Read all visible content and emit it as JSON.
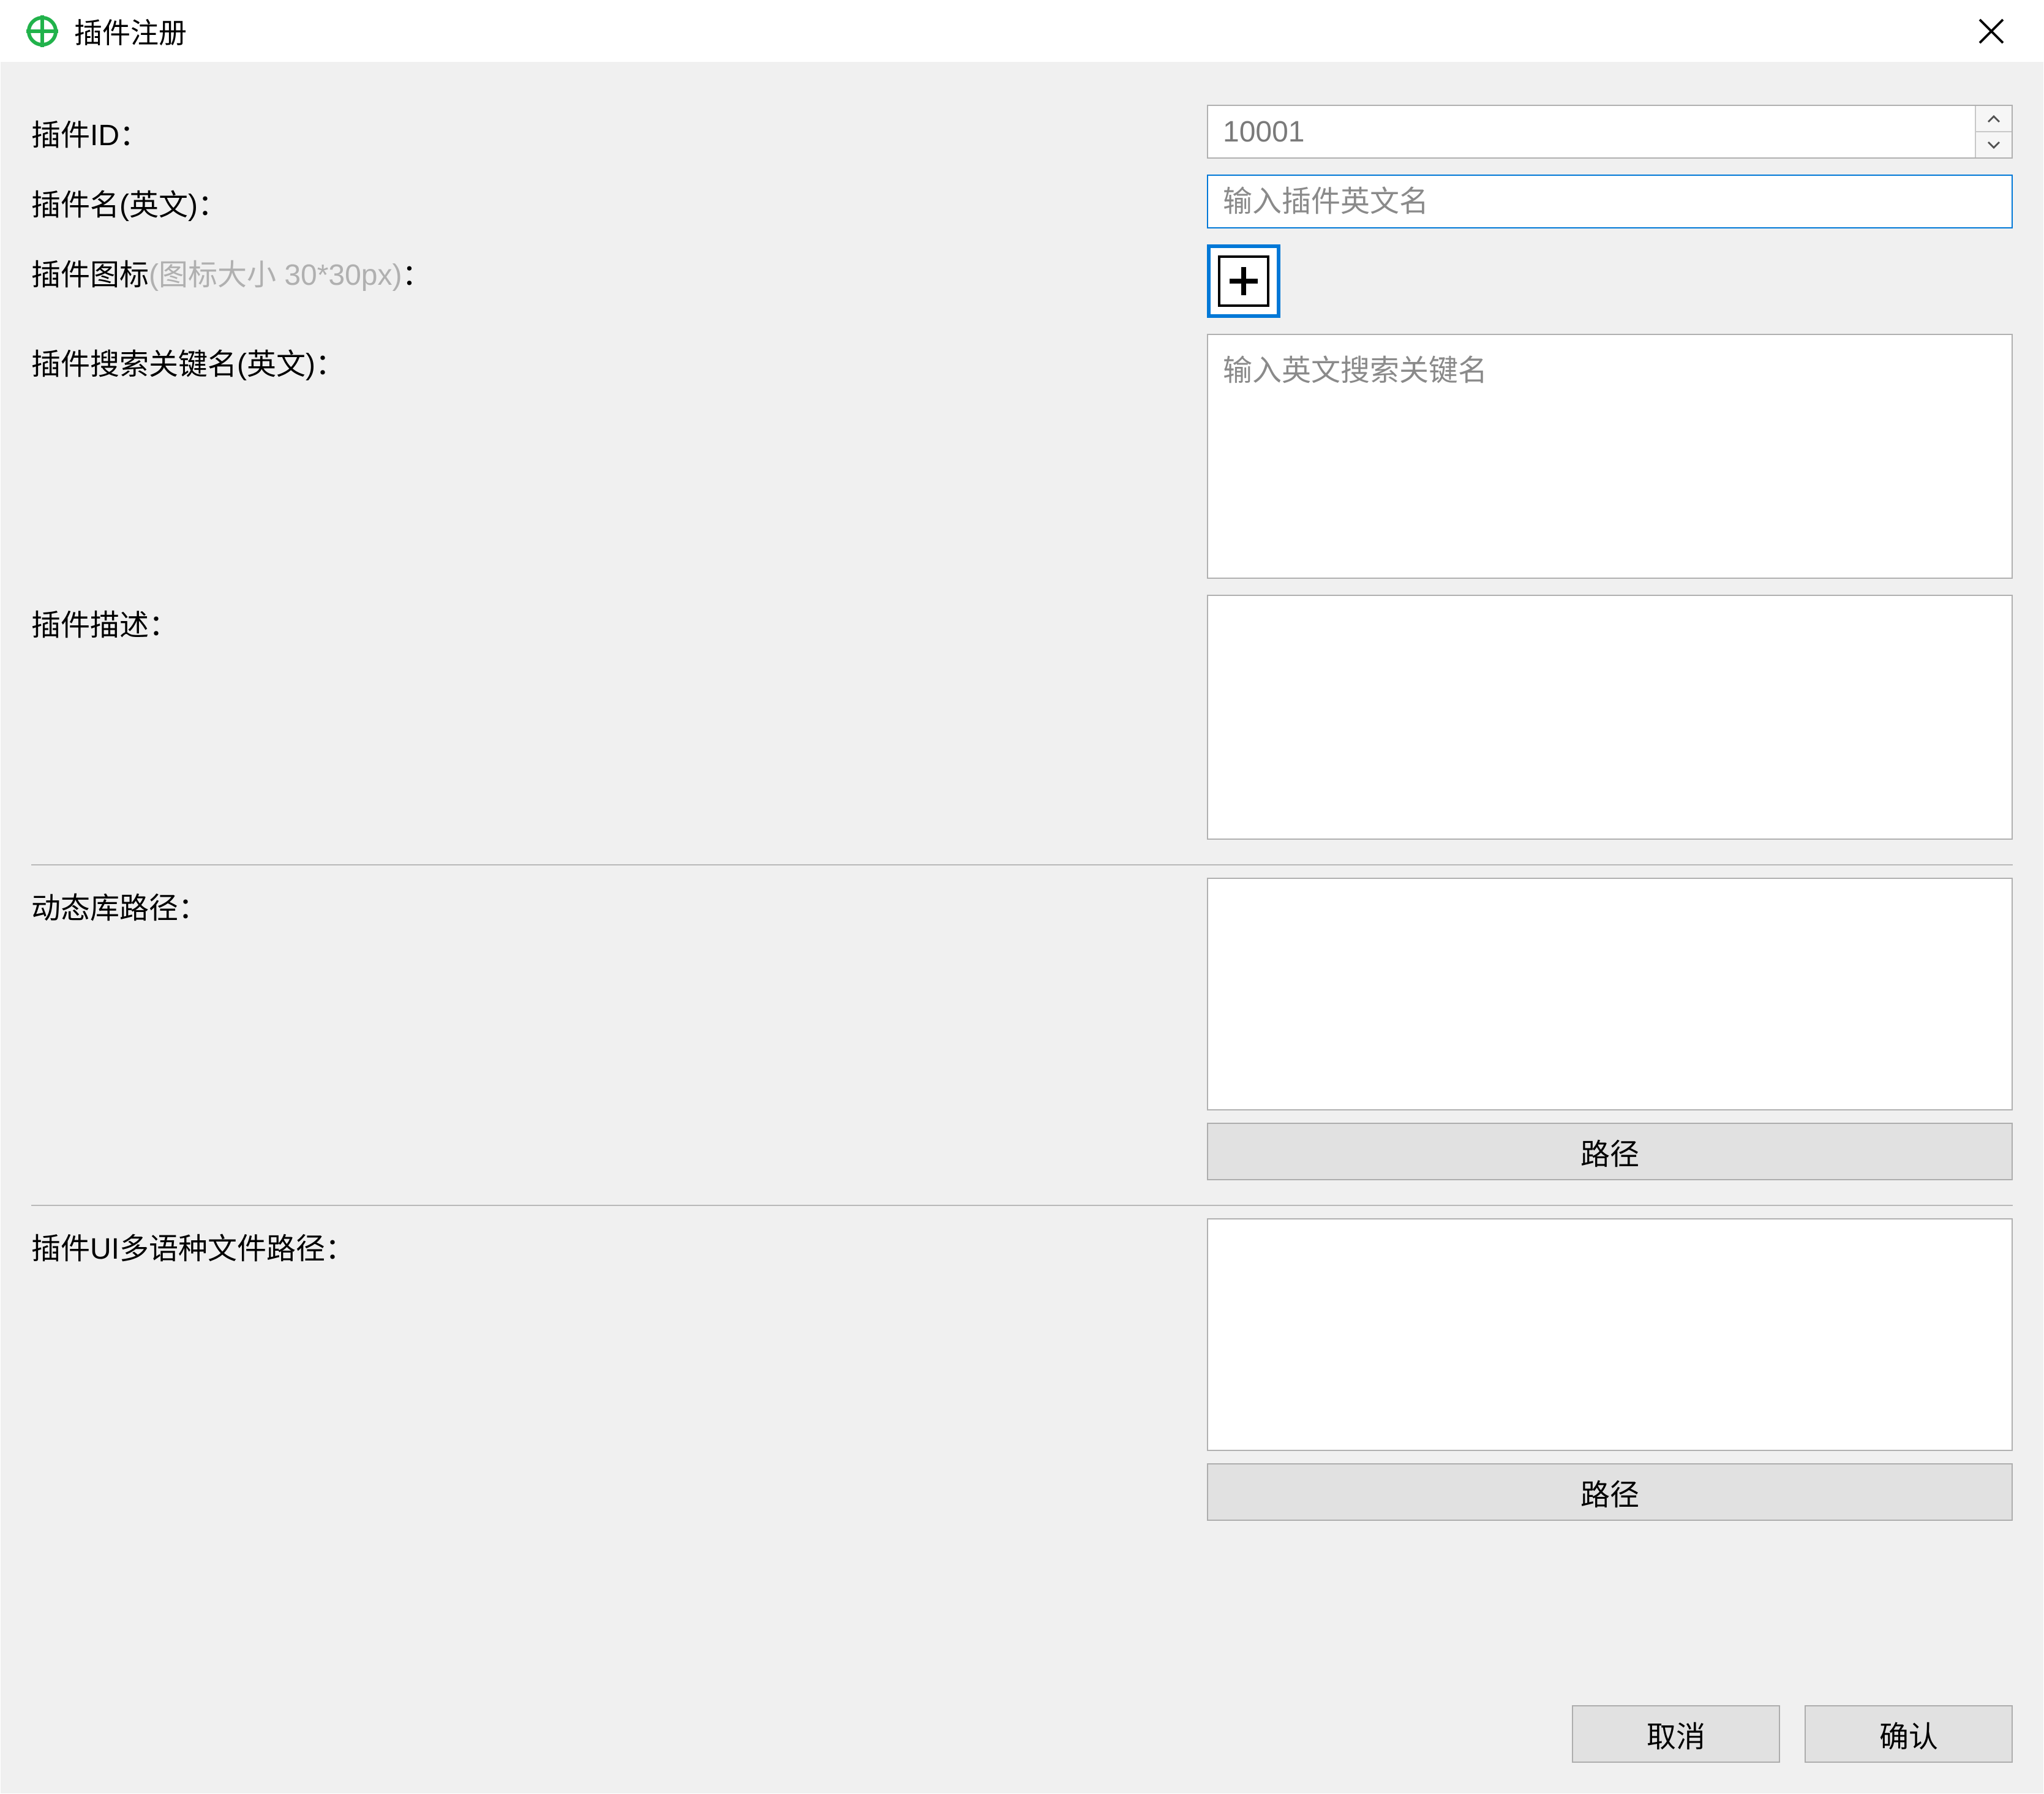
{
  "titlebar": {
    "title": "插件注册"
  },
  "sections": {
    "sec1": {
      "plugin_id": {
        "label": "插件ID：",
        "value": "10001"
      },
      "plugin_name_en": {
        "label": "插件名(英文)：",
        "placeholder": "输入插件英文名",
        "value": ""
      },
      "plugin_icon": {
        "label_prefix": "插件图标",
        "label_hint": "(图标大小 30*30px)",
        "label_suffix": "："
      },
      "plugin_keywords": {
        "label": "插件搜索关键名(英文)：",
        "placeholder": "输入英文搜索关键名",
        "value": ""
      },
      "plugin_desc": {
        "label": "插件描述：",
        "placeholder": "",
        "value": ""
      }
    },
    "sec2": {
      "dll_path": {
        "label": "动态库路径：",
        "placeholder": "",
        "value": "",
        "button": "路径"
      }
    },
    "sec3": {
      "ui_lang_path": {
        "label": "插件UI多语种文件路径：",
        "placeholder": "",
        "value": "",
        "button": "路径"
      }
    }
  },
  "footer": {
    "cancel": "取消",
    "confirm": "确认"
  }
}
